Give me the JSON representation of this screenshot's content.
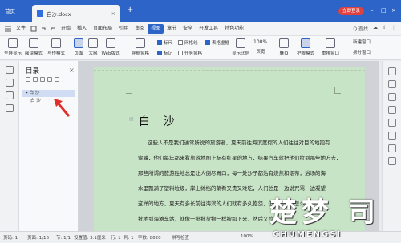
{
  "titlebar": {
    "home_label": "首页",
    "tab_title": "白沙.docx",
    "new_tab_symbol": "+",
    "login_label": "立即登录"
  },
  "menubar": {
    "items": [
      "文件",
      "开始",
      "插入",
      "页面布局",
      "引用",
      "审阅",
      "视图",
      "章节",
      "安全",
      "开发工具",
      "特色功能"
    ],
    "active_index": 6,
    "search_label": "Q 查找"
  },
  "ribbon": {
    "buttons": [
      "全屏显示",
      "阅读模式",
      "写作模式",
      "页面",
      "大纲",
      "Web版式",
      "导航窗格"
    ],
    "checkboxes": [
      {
        "label": "标尺",
        "checked": true
      },
      {
        "label": "网格线",
        "checked": false
      },
      {
        "label": "表格虚框",
        "checked": true
      },
      {
        "label": "标记",
        "checked": true
      },
      {
        "label": "任务窗格",
        "checked": false
      }
    ],
    "zoom_value": "100%",
    "right_buttons": [
      "显示比例",
      "页宽",
      "单页",
      "多页",
      "护眼模式",
      "重排窗口",
      "拆分窗口",
      "新建窗口"
    ]
  },
  "outline": {
    "title": "目录",
    "close_symbol": "×",
    "items": [
      {
        "label": "白 沙",
        "level": 1,
        "selected": true
      },
      {
        "label": "白 沙",
        "level": 2,
        "selected": false
      }
    ]
  },
  "document": {
    "heading": "白 沙",
    "lines": [
      "这些人不是我们通常所说的旅游者，夏天前往海滨度假的人们往往对目的地抱有",
      "索骥，他们每年都来看旅游地图上标有红星的地方，结果汽车就把他们拉到那些地方去，",
      "那些所谓的旅游胜地总是让人倒尽胃口，每一处沙子都沾有烧焦和烟蒂，浴场的海",
      "水里飘满了塑料垃圾，岸上摊档的菜肴又贵又难吃，人们总是一边说咒骂一边凝望",
      "这样的地方，夏天有多长前往海滨的人们就有多久抱怨，但是不知道怎么搞的，",
      "批地到海滩车站，就像一批批货物一样被卸下来，然后又拉回去。"
    ]
  },
  "statusbar": {
    "page": "页码: 1",
    "pages": "页面: 1/16",
    "section": "节: 1/1",
    "settings": "设置值: 3.1厘米",
    "row": "行: 1",
    "col": "列: 1",
    "words": "字数: 8620",
    "spell": "拼写检查",
    "zoom": "100%"
  },
  "watermark": {
    "big": "楚梦 司",
    "small": "CHUMENGSI"
  },
  "colors": {
    "accent": "#2c65c7",
    "page_background": "#c8e4c6",
    "login_red": "#e14040"
  }
}
